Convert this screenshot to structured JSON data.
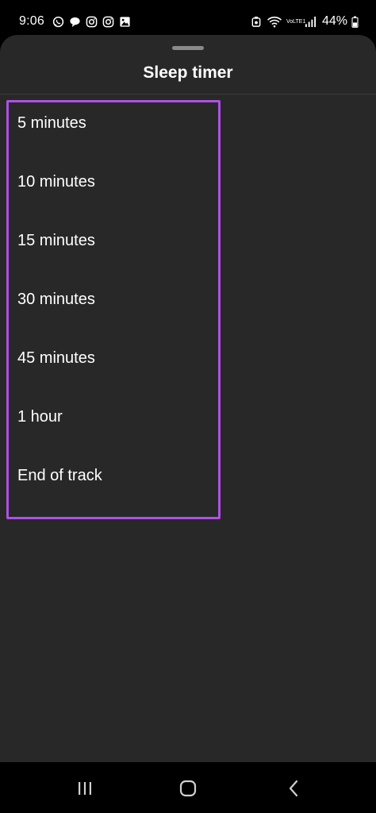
{
  "status_bar": {
    "time": "9:06",
    "battery_percent": "44%",
    "network_label": "VoLTE1",
    "icons_left": [
      "whatsapp-icon",
      "chat-icon",
      "instagram-icon",
      "instagram-icon",
      "gallery-icon"
    ],
    "icons_right": [
      "notification-icon",
      "wifi-icon",
      "volte-icon",
      "signal-icon",
      "battery-icon"
    ]
  },
  "sheet": {
    "title": "Sleep timer",
    "options": [
      {
        "label": "5 minutes"
      },
      {
        "label": "10 minutes"
      },
      {
        "label": "15 minutes"
      },
      {
        "label": "30 minutes"
      },
      {
        "label": "45 minutes"
      },
      {
        "label": "1 hour"
      },
      {
        "label": "End of track"
      }
    ],
    "highlight_color": "#b04fe6",
    "background_color": "#282828"
  },
  "nav_bar": {
    "buttons": [
      "recents-icon",
      "home-icon",
      "back-icon"
    ]
  }
}
